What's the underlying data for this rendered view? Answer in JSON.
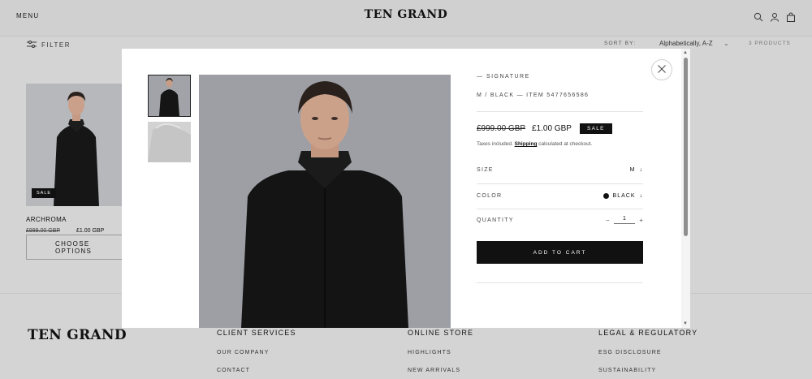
{
  "header": {
    "menu_label": "MENU",
    "brand": "TEN GRAND",
    "icons": [
      "search-icon",
      "account-icon",
      "cart-icon"
    ]
  },
  "toolbar": {
    "filter_label": "FILTER",
    "sort_label": "SORT BY:",
    "sort_value": "Alphabetically, A-Z",
    "products_count": "3 PRODUCTS"
  },
  "product_card": {
    "badge": "SALE",
    "name": "ARCHROMA",
    "old_price": "£999.00 GBP",
    "new_price": "£1.00 GBP",
    "button": "CHOOSE OPTIONS"
  },
  "footer": {
    "brand": "TEN GRAND",
    "columns": [
      {
        "title": "CLIENT SERVICES",
        "links": [
          "OUR COMPANY",
          "CONTACT"
        ]
      },
      {
        "title": "ONLINE STORE",
        "links": [
          "HIGHLIGHTS",
          "NEW ARRIVALS"
        ]
      },
      {
        "title": "LEGAL & REGULATORY",
        "links": [
          "ESG DISCLOSURE",
          "SUSTAINABILITY"
        ]
      }
    ]
  },
  "quick_view": {
    "collection": "— SIGNATURE",
    "variant_line": "M / BLACK — ITEM 5477656586",
    "old_price": "£999.00 GBP",
    "new_price": "£1.00 GBP",
    "badge": "SALE",
    "tax_prefix": "Taxes included. ",
    "tax_link": "Shipping",
    "tax_suffix": " calculated at checkout.",
    "size_label": "SIZE",
    "size_value": "M",
    "color_label": "COLOR",
    "color_value": "BLACK",
    "color_swatch": "#111111",
    "quantity_label": "QUANTITY",
    "quantity_minus": "−",
    "quantity_value": "1",
    "quantity_plus": "+",
    "chevron": "↓",
    "add_to_cart": "ADD TO CART"
  }
}
